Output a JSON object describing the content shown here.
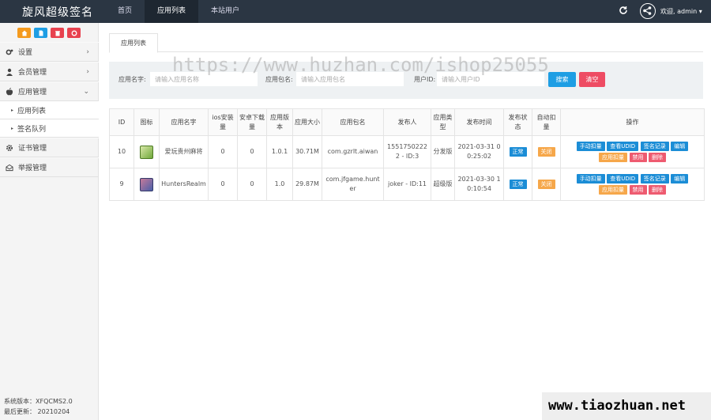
{
  "brand": "旋风超级签名",
  "nav": [
    "首页",
    "应用列表",
    "本站用户"
  ],
  "nav_active": 1,
  "user_greeting": "欢迎, admin ▾",
  "icons": {
    "refresh": "refresh-icon",
    "share": "share-icon"
  },
  "quick_buttons": [
    {
      "icon": "home-icon",
      "color": "#f49a1e"
    },
    {
      "icon": "file-icon",
      "color": "#1e9ee4"
    },
    {
      "icon": "trash-icon",
      "color": "#e8424f"
    },
    {
      "icon": "recycle-icon",
      "color": "#e8424f"
    }
  ],
  "sidebar": {
    "items": [
      {
        "label": "设置",
        "icon": "gears-icon"
      },
      {
        "label": "会员管理",
        "icon": "user-icon"
      },
      {
        "label": "应用管理",
        "icon": "apple-icon"
      }
    ],
    "sub_items": [
      "应用列表",
      "签名队列"
    ],
    "items_after": [
      {
        "label": "证书管理",
        "icon": "gear-icon"
      },
      {
        "label": "举报管理",
        "icon": "envelope-icon"
      }
    ]
  },
  "system": {
    "version": "系统版本：XFQCMS2.0",
    "updated": "最后更新： 20210204"
  },
  "tab_label": "应用列表",
  "search": {
    "name_label": "应用名字:",
    "name_placeholder": "请输入应用名称",
    "package_label": "应用包名:",
    "package_placeholder": "请输入应用包名",
    "userid_label": "用户ID:",
    "userid_placeholder": "请输入用户ID",
    "search_button": "搜索",
    "clear_button": "清空"
  },
  "table": {
    "headers": [
      "ID",
      "图标",
      "应用名字",
      "ios安装量",
      "安卓下载量",
      "应用版本",
      "应用大小",
      "应用包名",
      "发布人",
      "应用类型",
      "发布时间",
      "发布状态",
      "自动扣量",
      "操作"
    ],
    "rows": [
      {
        "id": "10",
        "icon_color": "#6fa83a",
        "name": "爱玩贵州麻将",
        "ios": "0",
        "android": "0",
        "version": "1.0.1",
        "size": "30.71M",
        "package": "com.gzrlt.aiwan",
        "publisher": "15517502222 - ID:3",
        "type": "分发版",
        "time": "2021-03-31 00:25:02",
        "status": "正常",
        "auto": "关闭",
        "ops": [
          {
            "label": "手动扣量",
            "color": "blue"
          },
          {
            "label": "查看UDID",
            "color": "blue"
          },
          {
            "label": "签名记录",
            "color": "blue"
          },
          {
            "label": "编辑",
            "color": "blue"
          },
          {
            "label": "应用扣量",
            "color": "orange"
          },
          {
            "label": "禁用",
            "color": "red"
          },
          {
            "label": "删除",
            "color": "red"
          }
        ]
      },
      {
        "id": "9",
        "icon_color": "#4a5fa8",
        "name": "HuntersRealm",
        "ios": "0",
        "android": "0",
        "version": "1.0",
        "size": "29.87M",
        "package": "com.jfgame.hunter",
        "publisher": "joker - ID:11",
        "type": "超级版",
        "time": "2021-03-30 10:10:54",
        "status": "正常",
        "auto": "关闭",
        "ops": [
          {
            "label": "手动扣量",
            "color": "blue"
          },
          {
            "label": "查看UDID",
            "color": "blue"
          },
          {
            "label": "签名记录",
            "color": "blue"
          },
          {
            "label": "编辑",
            "color": "blue"
          },
          {
            "label": "应用扣量",
            "color": "orange"
          },
          {
            "label": "禁用",
            "color": "red"
          },
          {
            "label": "删除",
            "color": "red"
          }
        ]
      }
    ]
  },
  "watermark_top": "https://www.huzhan.com/ishop25055",
  "watermark_bottom": "www.tiaozhuan.net"
}
